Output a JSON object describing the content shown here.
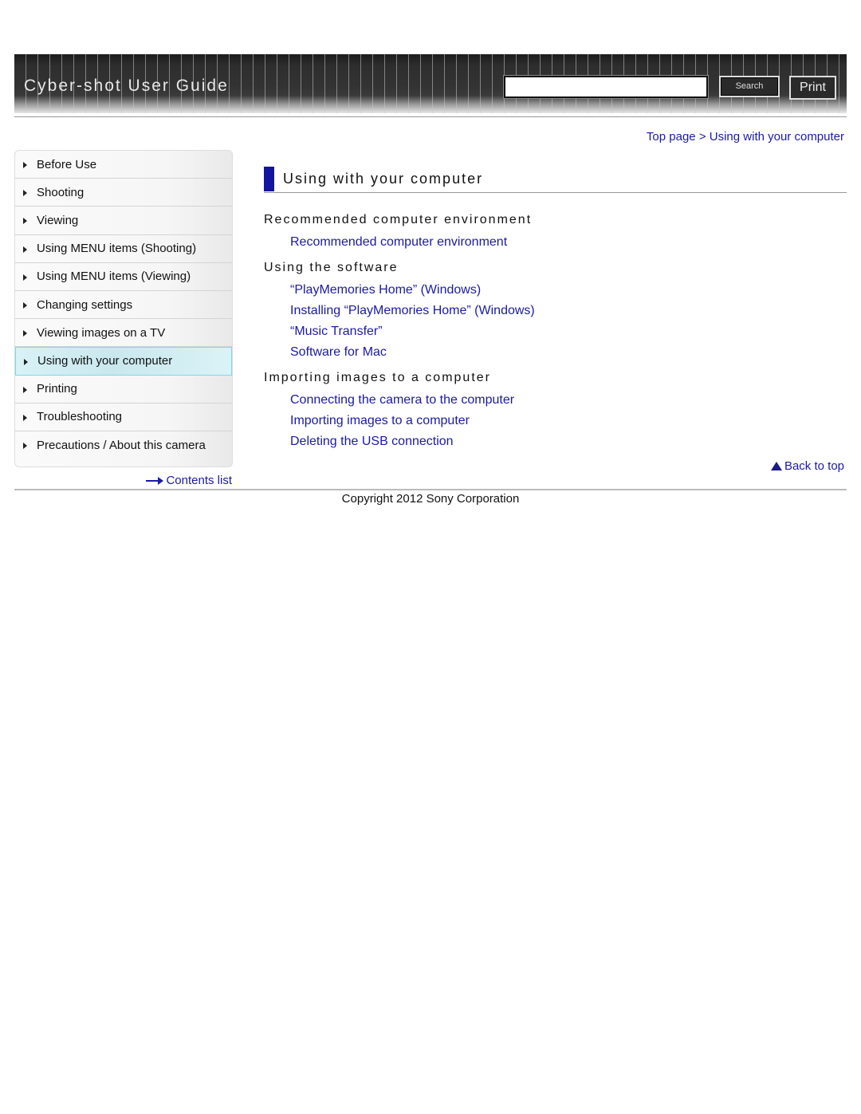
{
  "header": {
    "app_title": "Cyber-shot User Guide",
    "search_placeholder": "",
    "search_value": "",
    "search_label": "Search",
    "print_label": "Print"
  },
  "breadcrumb": {
    "items": [
      "Top page",
      "Using with your computer"
    ],
    "separator": " > "
  },
  "sidebar": {
    "items": [
      {
        "label": "Before Use",
        "active": false
      },
      {
        "label": "Shooting",
        "active": false
      },
      {
        "label": "Viewing",
        "active": false
      },
      {
        "label": "Using MENU items (Shooting)",
        "active": false
      },
      {
        "label": "Using MENU items (Viewing)",
        "active": false
      },
      {
        "label": "Changing settings",
        "active": false
      },
      {
        "label": "Viewing images on a TV",
        "active": false
      },
      {
        "label": "Using with your computer",
        "active": true
      },
      {
        "label": "Printing",
        "active": false
      },
      {
        "label": "Troubleshooting",
        "active": false
      },
      {
        "label": "Precautions / About this camera",
        "active": false
      }
    ],
    "contents_link": "Contents list"
  },
  "main": {
    "title": "Using with your computer",
    "sections": [
      {
        "heading": "Recommended computer environment",
        "links": [
          "Recommended computer environment"
        ]
      },
      {
        "heading": "Using the software",
        "links": [
          "“PlayMemories Home” (Windows)",
          "Installing “PlayMemories Home” (Windows)",
          "“Music Transfer”",
          "Software for Mac"
        ]
      },
      {
        "heading": "Importing images to a computer",
        "links": [
          "Connecting the camera to the computer",
          "Importing images to a computer",
          "Deleting the USB connection"
        ]
      }
    ],
    "back_to_top": "Back to top"
  },
  "footer": {
    "copyright": "Copyright 2012 Sony Corporation"
  },
  "colors": {
    "link": "#1a1aa6",
    "title_accent": "#1414a0",
    "active_nav": "#d8f2f7"
  }
}
